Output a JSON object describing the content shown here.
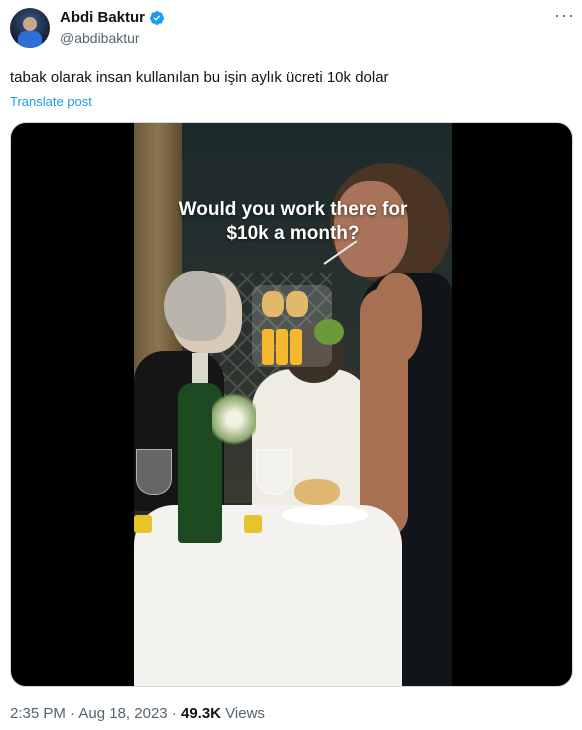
{
  "author": {
    "display_name": "Abdi Baktur",
    "handle": "@abdibaktur",
    "verified": true
  },
  "tweet": {
    "text": "tabak olarak insan kullanılan bu işin aylık ücreti 10k dolar",
    "translate_label": "Translate post"
  },
  "media": {
    "overlay_line1": "Would you work there for",
    "overlay_line2": "$10k a month?"
  },
  "meta": {
    "time": "2:35 PM",
    "separator": "·",
    "date": "Aug 18, 2023",
    "views_count": "49.3K",
    "views_label": "Views"
  },
  "colors": {
    "link": "#1d9bf0",
    "secondary_text": "#536471",
    "verified": "#1d9bf0"
  },
  "icons": [
    "verified-badge-icon",
    "more-options-icon"
  ]
}
